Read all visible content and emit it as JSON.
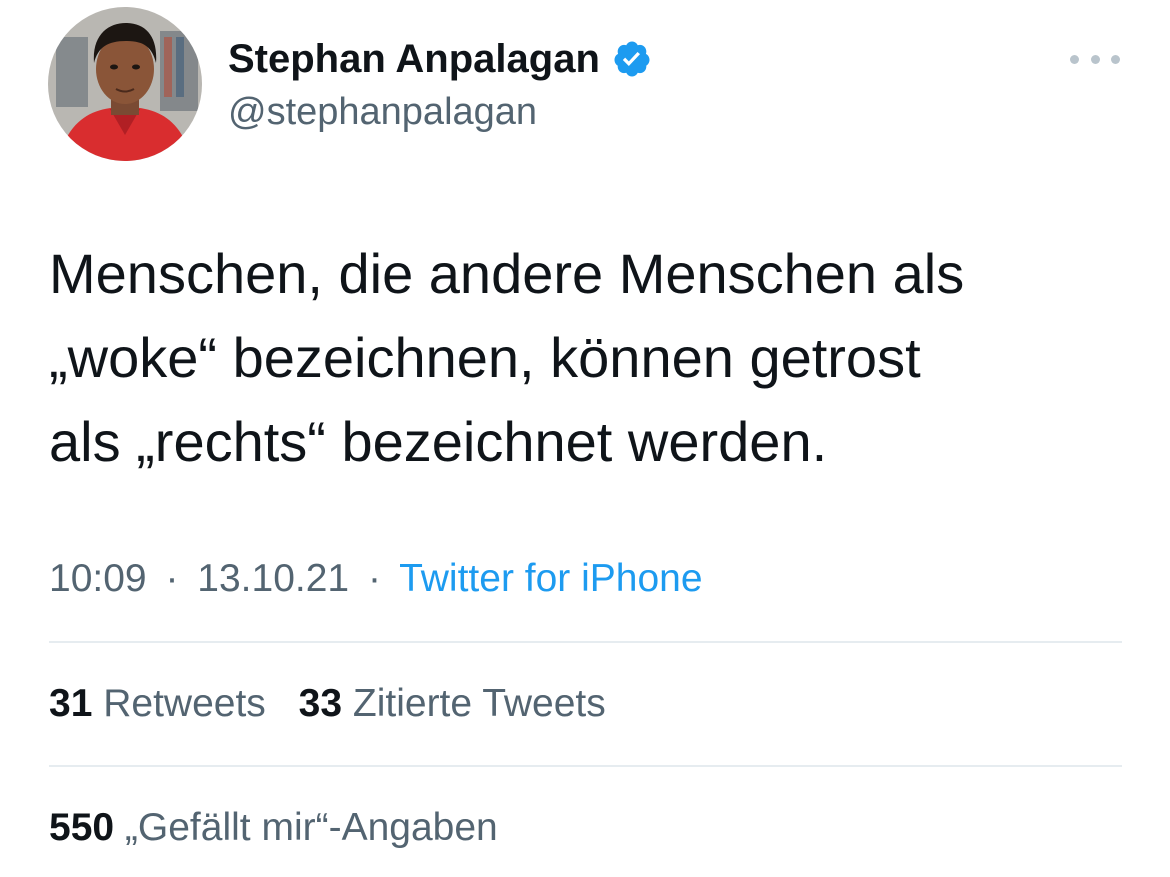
{
  "author": {
    "name": "Stephan Anpalagan",
    "handle": "@stephanpalagan",
    "verified": true,
    "verified_color": "#1d9bf0"
  },
  "more_icon": "more-horizontal-icon",
  "tweet": {
    "lines": [
      "Menschen, die andere Menschen als",
      "„woke“ bezeichnen, können getrost",
      "als „rechts“ bezeichnet werden."
    ]
  },
  "meta": {
    "time": "10:09",
    "separator": "·",
    "date": "13.10.21",
    "source": "Twitter for iPhone"
  },
  "stats": {
    "retweets_count": "31",
    "retweets_label": "Retweets",
    "quotes_count": "33",
    "quotes_label": "Zitierte Tweets",
    "likes_count": "550",
    "likes_label": "„Gefällt mir“-Angaben"
  },
  "colors": {
    "text": "#0f1419",
    "secondary": "#536471",
    "accent": "#1d9bf0",
    "divider": "#e6ecf0"
  }
}
